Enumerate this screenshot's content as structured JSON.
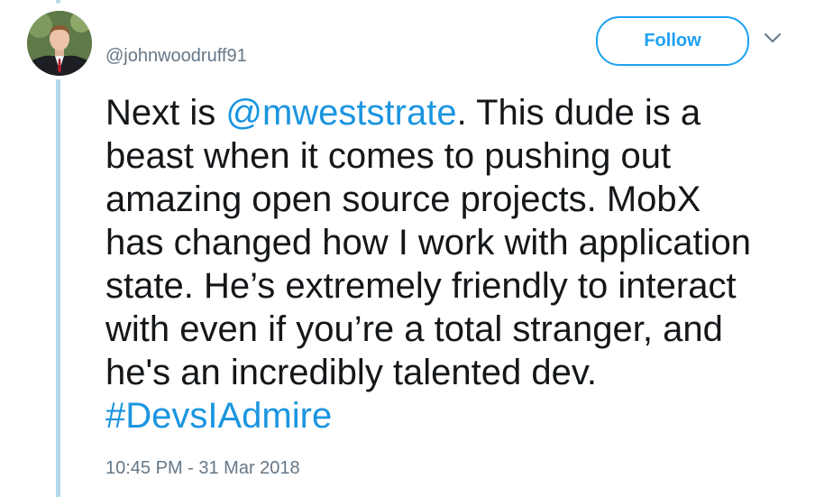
{
  "tweet": {
    "handle": "@johnwoodruff91",
    "follow_label": "Follow",
    "text_before_mention": "Next is ",
    "mention": "@mweststrate",
    "line1_rest": ". This dude is a",
    "line2": "beast when it comes to pushing out",
    "line3": "amazing open source projects. MobX",
    "line4": "has changed how I work with application",
    "line5": "state. He’s extremely friendly to interact",
    "line6": "with even if you’re a total stranger, and",
    "line7": "he's an incredibly talented dev.",
    "hashtag": "#DevsIAdmire",
    "timestamp": "10:45 PM - 31 Mar 2018"
  },
  "icons": {
    "caret": "chevron-down-icon",
    "avatar": "avatar"
  },
  "colors": {
    "link": "#1b95e0",
    "follow_accent": "#1da1f2",
    "thread_line": "#b5d9eb",
    "secondary_text": "#657786",
    "primary_text": "#14171a"
  }
}
